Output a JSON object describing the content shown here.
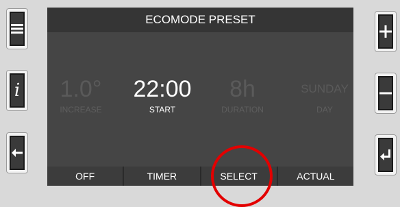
{
  "title": "ECOMODE PRESET",
  "params": [
    {
      "value": "1.0°",
      "label": "INCREASE"
    },
    {
      "value": "22:00",
      "label": "START"
    },
    {
      "value": "8h",
      "label": "DURATION"
    },
    {
      "value": "SUNDAY",
      "label": "DAY"
    }
  ],
  "softkeys": [
    "OFF",
    "TIMER",
    "SELECT",
    "ACTUAL"
  ],
  "side_left": [
    {
      "icon": "menu-icon"
    },
    {
      "icon": "info-icon",
      "glyph": "i"
    },
    {
      "icon": "back-arrow-icon"
    }
  ],
  "side_right": [
    {
      "icon": "plus-icon"
    },
    {
      "icon": "minus-icon"
    },
    {
      "icon": "enter-icon"
    }
  ],
  "colors": {
    "highlight_circle": "#e30000",
    "screen": "#454545",
    "titlebar": "#353535"
  }
}
